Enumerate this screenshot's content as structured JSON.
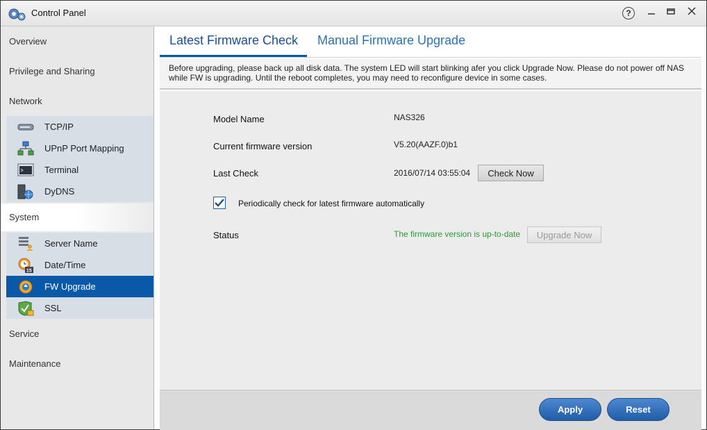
{
  "window": {
    "title": "Control Panel"
  },
  "sidebar": {
    "categories": {
      "overview": "Overview",
      "privilege": "Privilege and Sharing",
      "network": "Network",
      "system": "System",
      "service": "Service",
      "maintenance": "Maintenance"
    },
    "network_items": [
      "TCP/IP",
      "UPnP Port Mapping",
      "Terminal",
      "DyDNS"
    ],
    "system_items": [
      "Server Name",
      "Date/Time",
      "FW Upgrade",
      "SSL"
    ],
    "selected_item": "FW Upgrade"
  },
  "tabs": {
    "latest": "Latest Firmware Check",
    "manual": "Manual Firmware Upgrade",
    "active": "Latest Firmware Check"
  },
  "notice": "Before upgrading, please back up all disk data. The system LED will start blinking afer you click Upgrade Now. Please do not power off NAS while FW is upgrading. Until the reboot completes, you may need to reconfigure device in some cases.",
  "fields": {
    "model_name_label": "Model Name",
    "model_name_value": "NAS326",
    "fw_version_label": "Current firmware version",
    "fw_version_value": "V5.20(AAZF.0)b1",
    "last_check_label": "Last Check",
    "last_check_value": "2016/07/14 03:55:04",
    "check_now": "Check Now",
    "periodic_check_label": "Periodically check for latest firmware automatically",
    "periodic_check_checked": true,
    "status_label": "Status",
    "status_value": "The firmware version is up-to-date",
    "upgrade_now": "Upgrade Now"
  },
  "footer": {
    "apply": "Apply",
    "reset": "Reset"
  },
  "icons": {
    "app": "control-panel-icon",
    "help": "help-icon",
    "minimize": "minimize-icon",
    "maximize": "maximize-icon",
    "close": "close-icon",
    "tcpip": "network-device-icon",
    "upnp": "upnp-network-icon",
    "terminal": "terminal-icon",
    "dydns": "dns-icon",
    "server_name": "server-name-icon",
    "datetime": "clock-icon",
    "fw": "fw-upgrade-icon",
    "ssl": "ssl-shield-icon"
  },
  "colors": {
    "accent": "#0a58a8",
    "status_ok": "#2a9a3a",
    "button_blue": "#1f5da8"
  }
}
